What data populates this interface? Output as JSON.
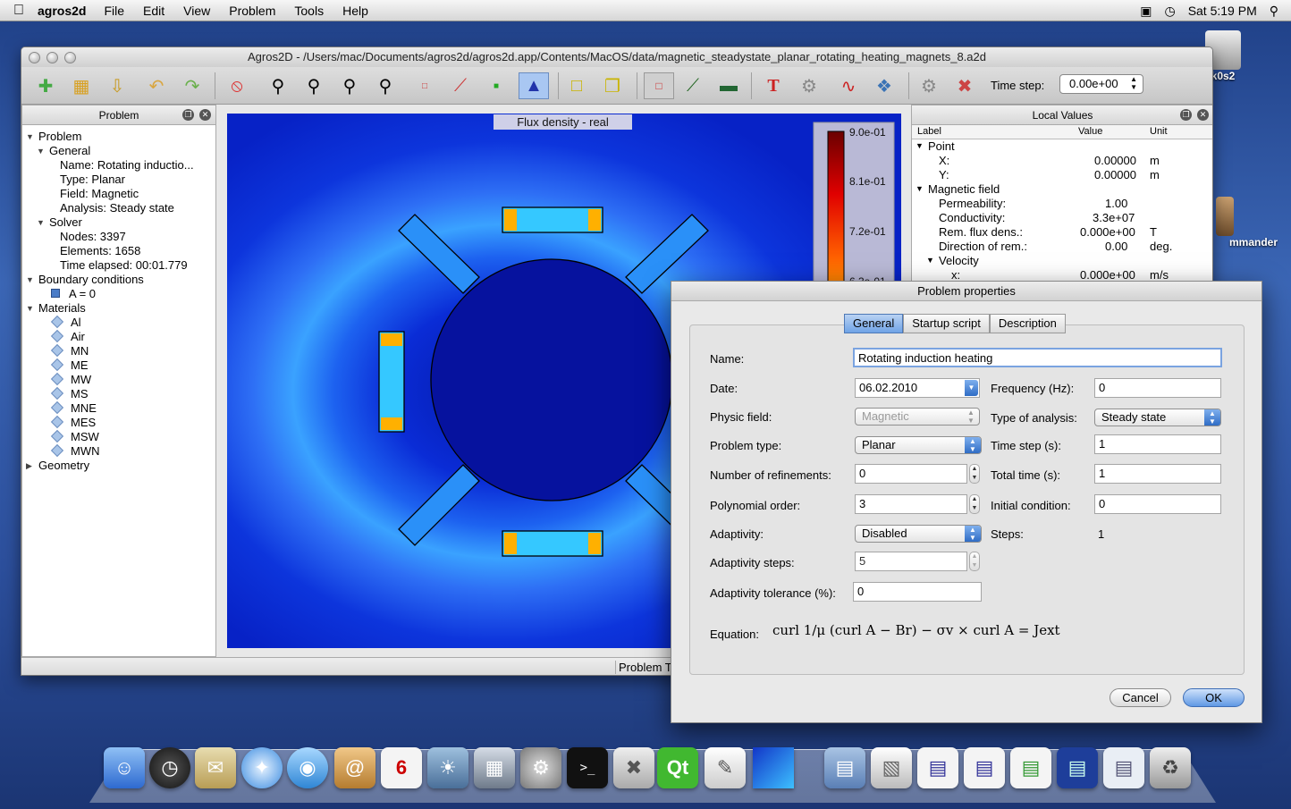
{
  "menubar": {
    "app_name": "agros2d",
    "menus": [
      "File",
      "Edit",
      "View",
      "Problem",
      "Tools",
      "Help"
    ],
    "clock": "Sat 5:19 PM"
  },
  "desktop": {
    "icon1": "k0s2",
    "icon2": "mmander"
  },
  "window": {
    "title": "Agros2D - /Users/mac/Documents/agros2d/agros2d.app/Contents/MacOS/data/magnetic_steadystate_planar_rotating_heating_magnets_8.a2d",
    "time_step_label": "Time step:",
    "time_step_value": "0.00e+00"
  },
  "problem_panel": {
    "title": "Problem",
    "items": {
      "problem": "Problem",
      "general": "General",
      "name": "Name: Rotating inductio...",
      "type": "Type: Planar",
      "field": "Field: Magnetic",
      "analysis": "Analysis: Steady state",
      "solver": "Solver",
      "nodes": "Nodes: 3397",
      "elements": "Elements: 1658",
      "time_elapsed": "Time elapsed: 00:01.779",
      "boundary": "Boundary conditions",
      "bc1": "A = 0",
      "materials": "Materials",
      "geometry": "Geometry"
    },
    "material_list": [
      "Al",
      "Air",
      "MN",
      "ME",
      "MW",
      "MS",
      "MNE",
      "MES",
      "MSW",
      "MWN"
    ]
  },
  "view": {
    "plot_title": "Flux density - real",
    "scale_labels": [
      "9.0e-01",
      "8.1e-01",
      "7.2e-01",
      "6.3e-01"
    ]
  },
  "local_values": {
    "title": "Local Values",
    "columns": [
      "Label",
      "Value",
      "Unit"
    ],
    "rows": [
      {
        "label": "Point",
        "value": "",
        "unit": ""
      },
      {
        "label": "X:",
        "value": "0.00000",
        "unit": "m"
      },
      {
        "label": "Y:",
        "value": "0.00000",
        "unit": "m"
      },
      {
        "label": "Magnetic field",
        "value": "",
        "unit": ""
      },
      {
        "label": "Permeability:",
        "value": "1.00",
        "unit": ""
      },
      {
        "label": "Conductivity:",
        "value": "3.3e+07",
        "unit": ""
      },
      {
        "label": "Rem. flux dens.:",
        "value": "0.000e+00",
        "unit": "T"
      },
      {
        "label": "Direction of rem.:",
        "value": "0.00",
        "unit": "deg."
      },
      {
        "label": "Velocity",
        "value": "",
        "unit": ""
      },
      {
        "label": "x:",
        "value": "0.000e+00",
        "unit": "m/s"
      }
    ]
  },
  "statusbar": {
    "text": "Problem T"
  },
  "dialog": {
    "title": "Problem properties",
    "tabs": [
      "General",
      "Startup script",
      "Description"
    ],
    "labels": {
      "name": "Name:",
      "date": "Date:",
      "physic_field": "Physic field:",
      "problem_type": "Problem type:",
      "refinements": "Number of refinements:",
      "poly_order": "Polynomial order:",
      "adaptivity": "Adaptivity:",
      "adaptivity_steps": "Adaptivity steps:",
      "adaptivity_tol": "Adaptivity tolerance (%):",
      "frequency": "Frequency (Hz):",
      "type_analysis": "Type of analysis:",
      "time_step": "Time step (s):",
      "total_time": "Total time (s):",
      "initial_condition": "Initial condition:",
      "steps": "Steps:",
      "equation": "Equation:"
    },
    "values": {
      "name": "Rotating induction heating",
      "date": "06.02.2010",
      "physic_field": "Magnetic",
      "problem_type": "Planar",
      "refinements": "0",
      "poly_order": "3",
      "adaptivity": "Disabled",
      "adaptivity_steps": "5",
      "adaptivity_tol": "0",
      "frequency": "0",
      "type_analysis": "Steady state",
      "time_step": "1",
      "total_time": "1",
      "initial_condition": "0",
      "steps": "1"
    },
    "equation_text": "curl 1/μ (curl A − Br) − σv × curl A = Jext",
    "cancel": "Cancel",
    "ok": "OK"
  }
}
